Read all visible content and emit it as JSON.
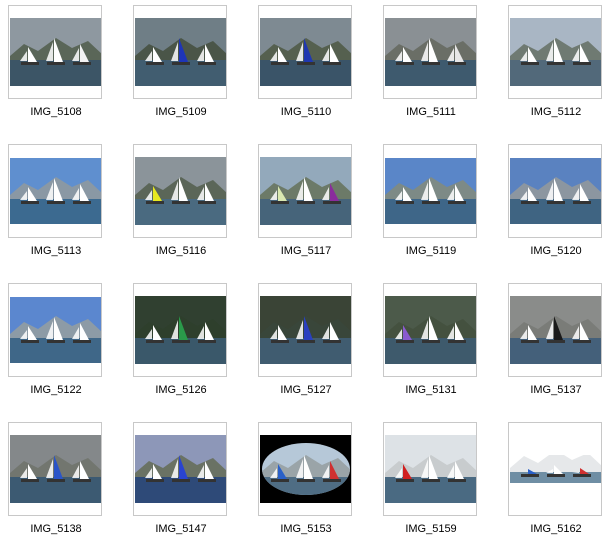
{
  "folder": {
    "items": [
      {
        "name": "IMG_5108",
        "sky": "#8e98a0",
        "water": "#3c5566",
        "land": "#5a6658",
        "sails": [
          "#ffffff",
          "#ffffff",
          "#f2f2f2"
        ],
        "crop": "full"
      },
      {
        "name": "IMG_5109",
        "sky": "#6f7e86",
        "water": "#415d70",
        "land": "#4a5548",
        "sails": [
          "#ffffff",
          "#1e35b8",
          "#ffffff"
        ],
        "crop": "full"
      },
      {
        "name": "IMG_5110",
        "sky": "#7e8a92",
        "water": "#3a5468",
        "land": "#55604f",
        "sails": [
          "#ffffff",
          "#2038b0",
          "#ffffff"
        ],
        "crop": "full"
      },
      {
        "name": "IMG_5111",
        "sky": "#8a9094",
        "water": "#3e5a6e",
        "land": "#6a6e66",
        "sails": [
          "#ffffff",
          "#ffffff",
          "#e7e7e7"
        ],
        "crop": "full"
      },
      {
        "name": "IMG_5112",
        "sky": "#a9b6c4",
        "water": "#52697a",
        "land": "#6f7a72",
        "sails": [
          "#ffffff",
          "#ffffff",
          "#ffffff"
        ],
        "crop": "full"
      },
      {
        "name": "IMG_5113",
        "sky": "#5f8fcf",
        "water": "#3c6a90",
        "land": "#8a98a4",
        "sails": [
          "#ffffff",
          "#ffffff",
          "#ffffff"
        ],
        "crop": "wide"
      },
      {
        "name": "IMG_5116",
        "sky": "#8b949a",
        "water": "#4a6a80",
        "land": "#5b6658",
        "sails": [
          "#e8e820",
          "#ffffff",
          "#ffffff"
        ],
        "crop": "full"
      },
      {
        "name": "IMG_5117",
        "sky": "#93a9bb",
        "water": "#46647a",
        "land": "#6c7a68",
        "sails": [
          "#d9e8b0",
          "#ffffff",
          "#8a2c9c"
        ],
        "crop": "full"
      },
      {
        "name": "IMG_5119",
        "sky": "#5a86c8",
        "water": "#3e6688",
        "land": "#7d8a86",
        "sails": [
          "#ffffff",
          "#ffffff",
          "#ffffff"
        ],
        "crop": "wide"
      },
      {
        "name": "IMG_5120",
        "sky": "#5a82c0",
        "water": "#3f6482",
        "land": "#8c96a0",
        "sails": [
          "#ffffff",
          "#ffffff",
          "#ffffff"
        ],
        "crop": "wide"
      },
      {
        "name": "IMG_5122",
        "sky": "#5b87cf",
        "water": "#3f6788",
        "land": "#8d9ba6",
        "sails": [
          "#ffffff",
          "#ffffff",
          "#ffffff"
        ],
        "crop": "wide"
      },
      {
        "name": "IMG_5126",
        "sky": "#304030",
        "water": "#3a586a",
        "land": "#2e3f2c",
        "sails": [
          "#ffffff",
          "#2a9a4a",
          "#ffffff"
        ],
        "crop": "full"
      },
      {
        "name": "IMG_5127",
        "sky": "#3a4436",
        "water": "#405c70",
        "land": "#39463a",
        "sails": [
          "#ffffff",
          "#2a40c0",
          "#ffffff"
        ],
        "crop": "full"
      },
      {
        "name": "IMG_5131",
        "sky": "#4c5a4a",
        "water": "#3e5a6c",
        "land": "#44513f",
        "sails": [
          "#8a5ad0",
          "#ffffff",
          "#ffffff"
        ],
        "crop": "full"
      },
      {
        "name": "IMG_5137",
        "sky": "#8a8c8a",
        "water": "#44607a",
        "land": "#7a7c78",
        "sails": [
          "#ffffff",
          "#1a1a1a",
          "#ffffff"
        ],
        "crop": "full"
      },
      {
        "name": "IMG_5138",
        "sky": "#84888a",
        "water": "#3c5a72",
        "land": "#72766f",
        "sails": [
          "#ffffff",
          "#2a54c8",
          "#ffffff"
        ],
        "crop": "full"
      },
      {
        "name": "IMG_5147",
        "sky": "#8d97b8",
        "water": "#2e4a78",
        "land": "#6a7264",
        "sails": [
          "#ffffff",
          "#2a44d0",
          "#ffffff"
        ],
        "crop": "full"
      },
      {
        "name": "IMG_5153",
        "sky": "#b6c8d8",
        "water": "#4f6d84",
        "land": "#9aa4a8",
        "sails": [
          "#2a60c8",
          "#ffffff",
          "#d03030"
        ],
        "crop": "oval"
      },
      {
        "name": "IMG_5159",
        "sky": "#dde2e6",
        "water": "#4a6a82",
        "land": "#c8ccce",
        "sails": [
          "#d02020",
          "#ffffff",
          "#ffffff"
        ],
        "crop": "full"
      },
      {
        "name": "IMG_5162",
        "sky": "#ffffff",
        "water": "#6f8ea4",
        "land": "#e6e8ea",
        "sails": [
          "#2a60c8",
          "#ffffff",
          "#d03030"
        ],
        "crop": "strip"
      }
    ]
  }
}
